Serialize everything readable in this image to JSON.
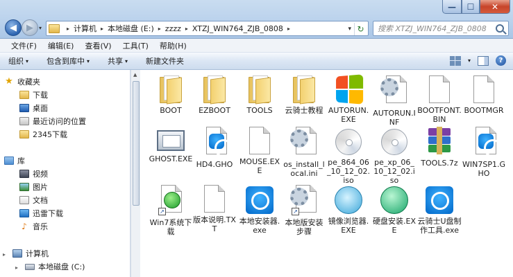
{
  "window": {
    "minimize_glyph": "—",
    "maximize_glyph": "☐",
    "close_glyph": "✕"
  },
  "address": {
    "crumbs": [
      "计算机",
      "本地磁盘 (E:)",
      "zzzz",
      "XTZJ_WIN764_ZJB_0808"
    ],
    "separator": "▸",
    "dropdown_glyph": "▾",
    "refresh_glyph": "↻"
  },
  "search": {
    "placeholder": "搜索 XTZJ_WIN764_ZJB_0808"
  },
  "menu": {
    "items": [
      "文件(F)",
      "编辑(E)",
      "查看(V)",
      "工具(T)",
      "帮助(H)"
    ]
  },
  "toolbar": {
    "organize": "组织",
    "include_in_library": "包含到库中",
    "share": "共享",
    "new_folder": "新建文件夹",
    "caret": "▾"
  },
  "navpane": {
    "favorites_title": "收藏夹",
    "favorites": [
      "下载",
      "桌面",
      "最近访问的位置",
      "2345下载"
    ],
    "libraries_title": "库",
    "libraries": [
      "视频",
      "图片",
      "文档",
      "迅雷下载",
      "音乐"
    ],
    "computer_title": "计算机",
    "drives": [
      "本地磁盘 (C:)"
    ]
  },
  "files": [
    {
      "name": "BOOT",
      "icon": "folder-icon"
    },
    {
      "name": "EZBOOT",
      "icon": "folder-icon"
    },
    {
      "name": "TOOLS",
      "icon": "folder-icon"
    },
    {
      "name": "云骑士教程",
      "icon": "folder-icon"
    },
    {
      "name": "AUTORUN.EXE",
      "icon": "windows-logo-icon"
    },
    {
      "name": "AUTORUN.INF",
      "icon": "settings-file-icon"
    },
    {
      "name": "BOOTFONT.BIN",
      "icon": "blank-file-icon"
    },
    {
      "name": "BOOTMGR",
      "icon": "blank-file-icon"
    },
    {
      "name": "GHOST.EXE",
      "icon": "ghost-app-icon"
    },
    {
      "name": "HD4.GHO",
      "icon": "gho-file-icon"
    },
    {
      "name": "MOUSE.EXE",
      "icon": "blank-file-icon"
    },
    {
      "name": "os_install_local.ini",
      "icon": "settings-file-icon"
    },
    {
      "name": "pe_864_06_10_12_02.iso",
      "icon": "disc-image-icon"
    },
    {
      "name": "pe_xp_06_10_12_02.iso",
      "icon": "disc-image-icon"
    },
    {
      "name": "TOOLS.7z",
      "icon": "archive-icon"
    },
    {
      "name": "WIN7SP1.GHO",
      "icon": "gho-file-icon"
    },
    {
      "name": "Win7系统下载",
      "icon": "green-shortcut-icon"
    },
    {
      "name": "版本说明.TXT",
      "icon": "text-file-icon"
    },
    {
      "name": "本地安装器.exe",
      "icon": "installer-app-icon"
    },
    {
      "name": "本地版安装步骤",
      "icon": "settings-shortcut-icon"
    },
    {
      "name": "镜像浏览器.EXE",
      "icon": "browser-app-icon"
    },
    {
      "name": "硬盘安装.EXE",
      "icon": "disk-install-icon"
    },
    {
      "name": "云骑士U盘制作工具.exe",
      "icon": "installer-app-icon"
    }
  ],
  "icons": {
    "help": "?",
    "star": "★",
    "music_note": "♪"
  }
}
